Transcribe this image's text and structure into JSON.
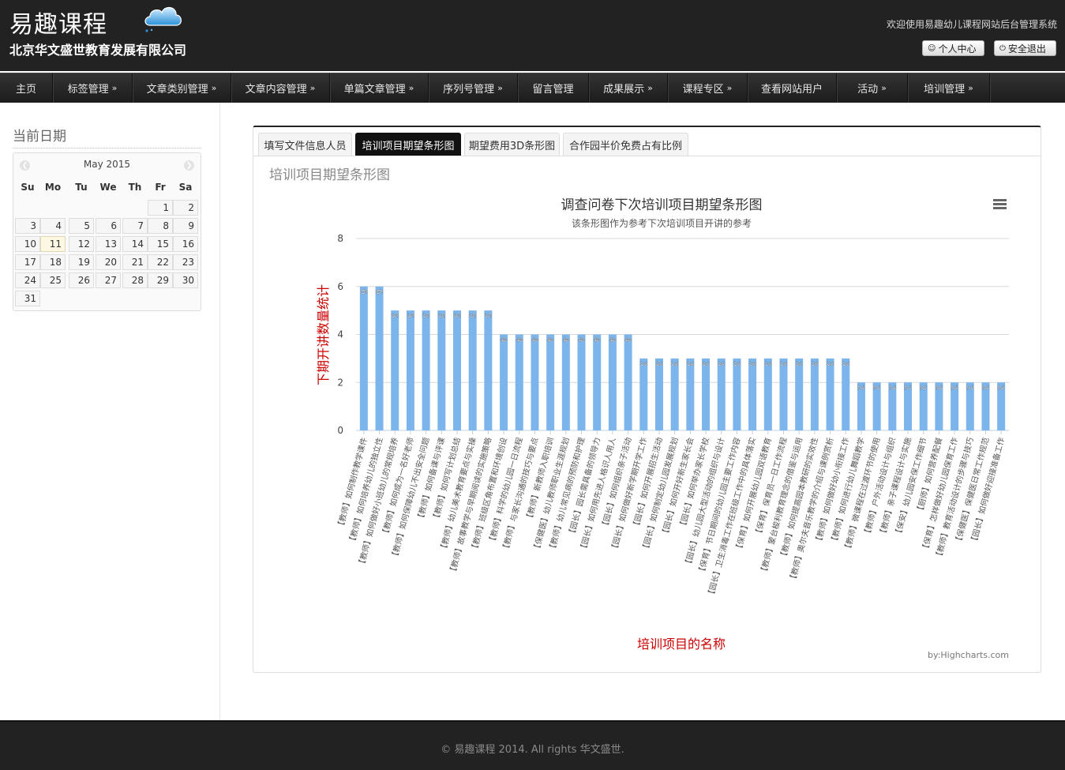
{
  "header": {
    "brand": "易趣课程",
    "company": "北京华文盛世教育发展有限公司",
    "welcome": "欢迎使用易趣幼儿课程网站后台管理系统",
    "profile_label": "个人中心",
    "logout_label": "安全退出"
  },
  "nav": [
    {
      "label": "主页",
      "caret": ""
    },
    {
      "label": "标签管理",
      "caret": "»"
    },
    {
      "label": "文章类别管理",
      "caret": "»"
    },
    {
      "label": "文章内容管理",
      "caret": "»"
    },
    {
      "label": "单篇文章管理",
      "caret": "»"
    },
    {
      "label": "序列号管理",
      "caret": "»"
    },
    {
      "label": "留言管理",
      "caret": ""
    },
    {
      "label": "成果展示",
      "caret": "»"
    },
    {
      "label": "课程专区",
      "caret": "»"
    },
    {
      "label": "查看网站用户",
      "caret": ""
    },
    {
      "label": "活动",
      "caret": "»"
    },
    {
      "label": "培训管理",
      "caret": "»"
    }
  ],
  "sidebar": {
    "title": "当前日期",
    "calendar": {
      "month_label": "May 2015",
      "weekdays": [
        "Su",
        "Mo",
        "Tu",
        "We",
        "Th",
        "Fr",
        "Sa"
      ],
      "first_weekday": 5,
      "days_in_month": 31,
      "today": 11
    }
  },
  "tabs": [
    {
      "label": "填写文件信息人员",
      "active": false
    },
    {
      "label": "培训项目期望条形图",
      "active": true
    },
    {
      "label": "期望费用3D条形图",
      "active": false
    },
    {
      "label": "合作园半价免费占有比例",
      "active": false
    }
  ],
  "section_title": "培训项目期望条形图",
  "chart_data": {
    "type": "bar",
    "title": "调查问卷下次培训项目期望条形图",
    "subtitle": "该条形图作为参考下次培训项目开讲的参考",
    "xlabel": "培训项目的名称",
    "ylabel": "下期开讲数量统计",
    "ylim": [
      0,
      8
    ],
    "yticks": [
      0,
      2,
      4,
      6,
      8
    ],
    "grid": true,
    "credits": "by:Highcharts.com",
    "bar_color": "#7cb5ec",
    "categories": [
      "【教师】如何制作教学课件",
      "【教师】如何培养幼儿的独立性",
      "【教师】如何做好小班幼儿的常规培养",
      "【教师】如何成为一名好老师",
      "【教师】如何保障幼儿不出安全问题",
      "【教师】如何备课与评课",
      "【教师】如何写计划总结",
      "【教师】幼儿美术教育要点与实操",
      "【教师】故事教学与早期阅读的实施策略",
      "【教师】班级区角布置和环境创设",
      "【教师】科学的幼儿园一日流程",
      "【教师】与家长沟通的技巧与要点",
      "【教师】新教师入职培训",
      "【保健医】幼儿教师职业生涯规划",
      "【教师】幼儿常见病的预防和护理",
      "【园长】园长需具备的领导力",
      "【园长】如何用先进人格识人用人",
      "【园长】如何组织亲子活动",
      "【园长】如何做好新学期开学工作",
      "【园长】如何开展招生活动",
      "【园长】如何制定幼儿园发展规划",
      "【园长】如何开好新生家长会",
      "【园长】如何举办家长学校",
      "【园长】幼儿园大型活动的组织与设计",
      "【保育】节日期间的幼儿园主要工作内容",
      "【园长】卫生消毒工作在班级工作中的具体落实",
      "【保育】如何开展幼儿园双语教育",
      "【保育】保育员一日工作流程",
      "【教师】蒙台梭利教育理念的借鉴与运用",
      "【教师】如何提高园本教研的实效性",
      "【教师】奥尔夫音乐教学的介绍与课例赏析",
      "【教师】如何做好幼小衔接工作",
      "【教师】如何进行幼儿舞蹈教学",
      "【教师】微课程在过渡环节的使用",
      "【教师】户外活动设计与组织",
      "【教师】亲子课程设计与实施",
      "【保安】幼儿园安保工作细节",
      "【厨师】如何营养配餐",
      "【保育】怎样做好幼儿园保育工作",
      "【教师】教育活动设计的步骤与技巧",
      "【保健医】保健医日常工作规范",
      "【园长】如何做好迎接准备工作"
    ],
    "values": [
      6,
      6,
      5,
      5,
      5,
      5,
      5,
      5,
      5,
      4,
      4,
      4,
      4,
      4,
      4,
      4,
      4,
      4,
      3,
      3,
      3,
      3,
      3,
      3,
      3,
      3,
      3,
      3,
      3,
      3,
      3,
      3,
      2,
      2,
      2,
      2,
      2,
      2,
      2,
      2,
      2,
      2
    ]
  },
  "footer": {
    "text": "© 易趣课程 2014. All rights 华文盛世."
  }
}
